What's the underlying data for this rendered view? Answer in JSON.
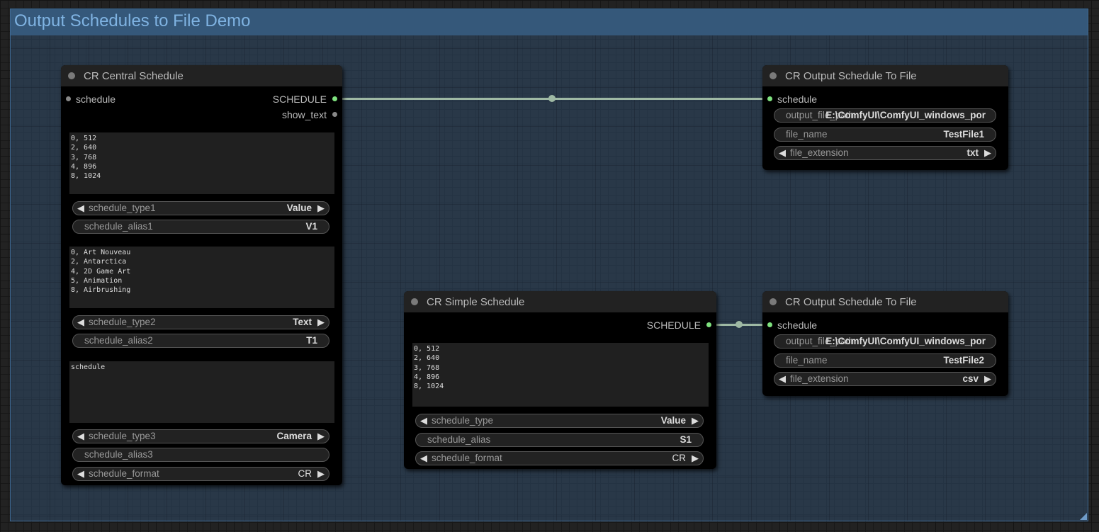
{
  "group": {
    "title": "Output Schedules to File Demo"
  },
  "central": {
    "title": "CR Central Schedule",
    "input_schedule": "schedule",
    "output_schedule": "SCHEDULE",
    "output_show_text": "show_text",
    "text1": "0, 512\n2, 640\n3, 768\n4, 896\n8, 1024",
    "schedule_type1": {
      "label": "schedule_type1",
      "value": "Value"
    },
    "schedule_alias1": {
      "label": "schedule_alias1",
      "value": "V1"
    },
    "text2": "0, Art Nouveau\n2, Antarctica\n4, 2D Game Art\n5, Animation\n8, Airbrushing",
    "schedule_type2": {
      "label": "schedule_type2",
      "value": "Text"
    },
    "schedule_alias2": {
      "label": "schedule_alias2",
      "value": "T1"
    },
    "text3": "schedule",
    "schedule_type3": {
      "label": "schedule_type3",
      "value": "Camera"
    },
    "schedule_alias3": {
      "label": "schedule_alias3",
      "value": ""
    },
    "schedule_format": {
      "label": "schedule_format",
      "value": "CR"
    }
  },
  "simple": {
    "title": "CR Simple Schedule",
    "output_schedule": "SCHEDULE",
    "text": "0, 512\n2, 640\n3, 768\n4, 896\n8, 1024",
    "schedule_type": {
      "label": "schedule_type",
      "value": "Value"
    },
    "schedule_alias": {
      "label": "schedule_alias",
      "value": "S1"
    },
    "schedule_format": {
      "label": "schedule_format",
      "value": "CR"
    }
  },
  "output1": {
    "title": "CR Output Schedule To File",
    "input_schedule": "schedule",
    "output_file_path": {
      "label": "output_file_path",
      "value": "E:\\ComfyUI\\ComfyUI_windows_por"
    },
    "file_name": {
      "label": "file_name",
      "value": "TestFile1"
    },
    "file_extension": {
      "label": "file_extension",
      "value": "txt"
    }
  },
  "output2": {
    "title": "CR Output Schedule To File",
    "input_schedule": "schedule",
    "output_file_path": {
      "label": "output_file_path",
      "value": "E:\\ComfyUI\\ComfyUI_windows_por"
    },
    "file_name": {
      "label": "file_name",
      "value": "TestFile2"
    },
    "file_extension": {
      "label": "file_extension",
      "value": "csv"
    }
  },
  "colors": {
    "link": "#9fb9a4",
    "slot_active": "#7fe27f",
    "group_bg": "#335577"
  }
}
